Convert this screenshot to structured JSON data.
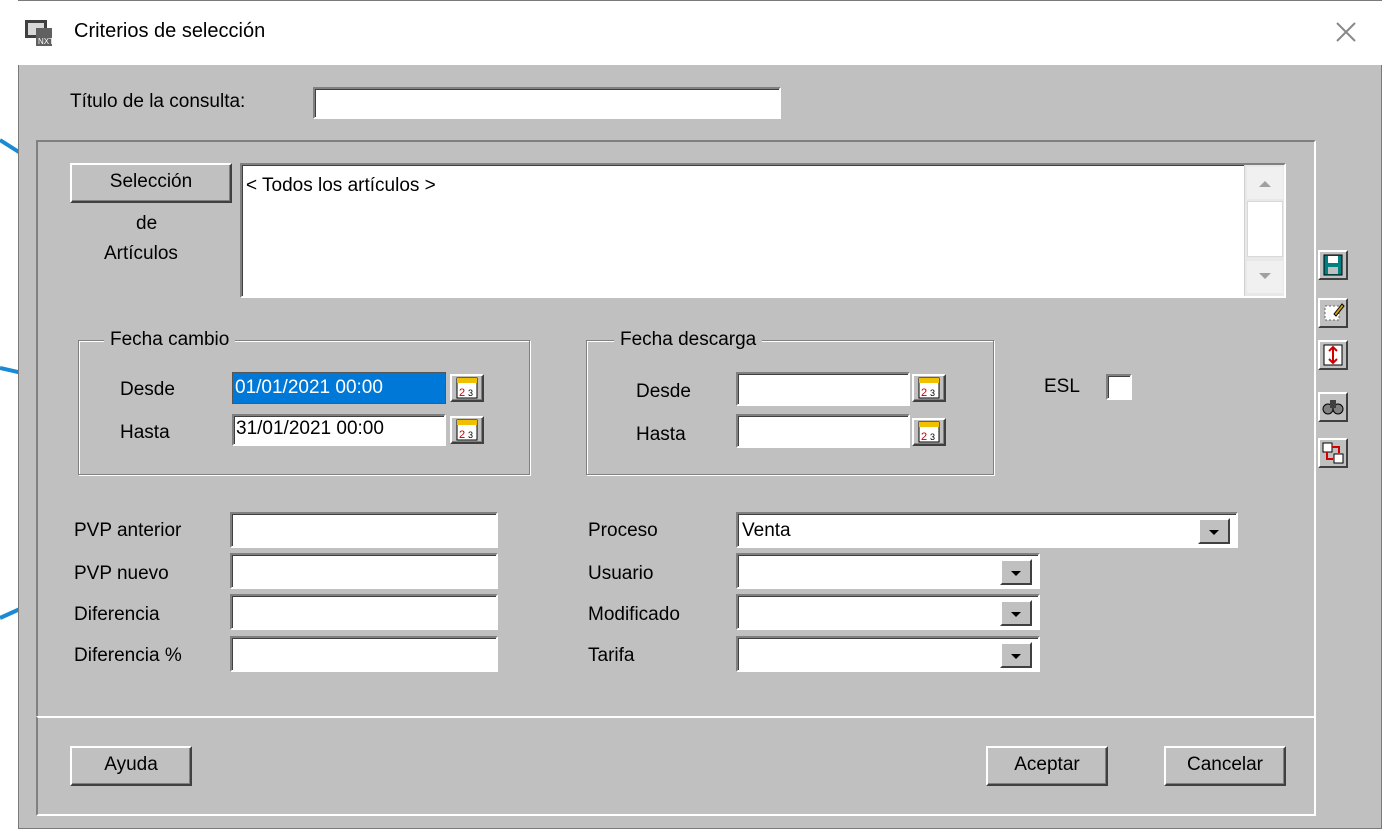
{
  "window": {
    "title": "Criterios de selección",
    "close_icon": "close-icon"
  },
  "query_title": {
    "label": "Título de la consulta:",
    "value": ""
  },
  "article_selection": {
    "button_label": "Selección",
    "caption_line1": "de",
    "caption_line2": "Artículos",
    "list_value": "< Todos los artículos >"
  },
  "fecha_cambio": {
    "legend": "Fecha cambio",
    "desde_label": "Desde",
    "desde_value": "01/01/2021 00:00",
    "hasta_label": "Hasta",
    "hasta_value": "31/01/2021 00:00"
  },
  "fecha_descarga": {
    "legend": "Fecha descarga",
    "desde_label": "Desde",
    "desde_value": "",
    "hasta_label": "Hasta",
    "hasta_value": ""
  },
  "esl": {
    "label": "ESL",
    "checked": false
  },
  "prices": {
    "pvp_anterior_label": "PVP anterior",
    "pvp_nuevo_label": "PVP nuevo",
    "diferencia_label": "Diferencia",
    "diferencia_pct_label": "Diferencia %"
  },
  "filters": {
    "proceso_label": "Proceso",
    "proceso_value": "Venta",
    "usuario_label": "Usuario",
    "usuario_value": "",
    "modificado_label": "Modificado",
    "modificado_value": "",
    "tarifa_label": "Tarifa",
    "tarifa_value": ""
  },
  "footer": {
    "help_label": "Ayuda",
    "accept_label": "Aceptar",
    "cancel_label": "Cancelar"
  },
  "colors": {
    "selection": "#0078d7",
    "arrow": "#1a8ad4",
    "face": "#c0c0c0"
  }
}
